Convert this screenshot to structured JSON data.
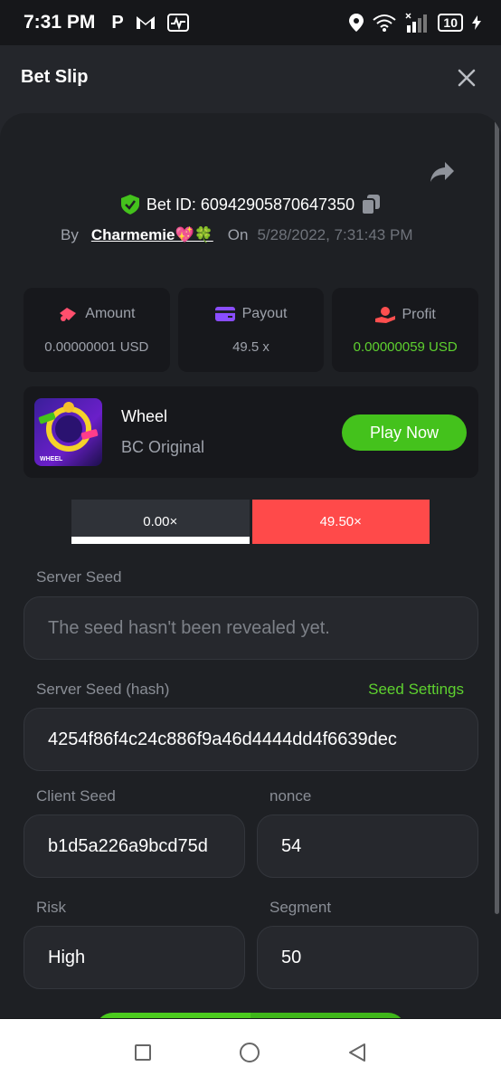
{
  "status_bar": {
    "time": "7:31 PM",
    "app_icons": [
      "p-icon",
      "gmail-icon",
      "activity-icon"
    ],
    "battery": "10"
  },
  "header": {
    "title": "Bet Slip"
  },
  "bet": {
    "id_label": "Bet ID: 60942905870647350",
    "by_label": "By",
    "user": "Charmemie💖🍀",
    "on_label": "On",
    "date": "5/28/2022, 7:31:43 PM"
  },
  "stats": [
    {
      "label": "Amount",
      "value": "0.00000001 USD",
      "icon": "amount-icon"
    },
    {
      "label": "Payout",
      "value": "49.5 x",
      "icon": "payout-icon"
    },
    {
      "label": "Profit",
      "value": "0.00000059 USD",
      "icon": "profit-icon"
    }
  ],
  "game": {
    "name": "Wheel",
    "subtitle": "BC Original",
    "thumb_text": "WHEEL",
    "play_label": "Play Now"
  },
  "multipliers": {
    "left": "0.00×",
    "right": "49.50×"
  },
  "fields": {
    "server_seed_label": "Server Seed",
    "server_seed_value": "The seed hasn't been revealed yet.",
    "server_seed_hash_label": "Server Seed (hash)",
    "seed_settings_label": "Seed Settings",
    "server_seed_hash_value": "4254f86f4c24c886f9a46d4444dd4f6639dec",
    "client_seed_label": "Client Seed",
    "client_seed_value": "b1d5a226a9bcd75d",
    "nonce_label": "nonce",
    "nonce_value": "54",
    "risk_label": "Risk",
    "risk_value": "High",
    "segment_label": "Segment",
    "segment_value": "50"
  },
  "colors": {
    "accent_green": "#44c21c",
    "profit_green": "#5ed12f",
    "loss_red": "#ff4a4a",
    "background": "#1e2024"
  }
}
